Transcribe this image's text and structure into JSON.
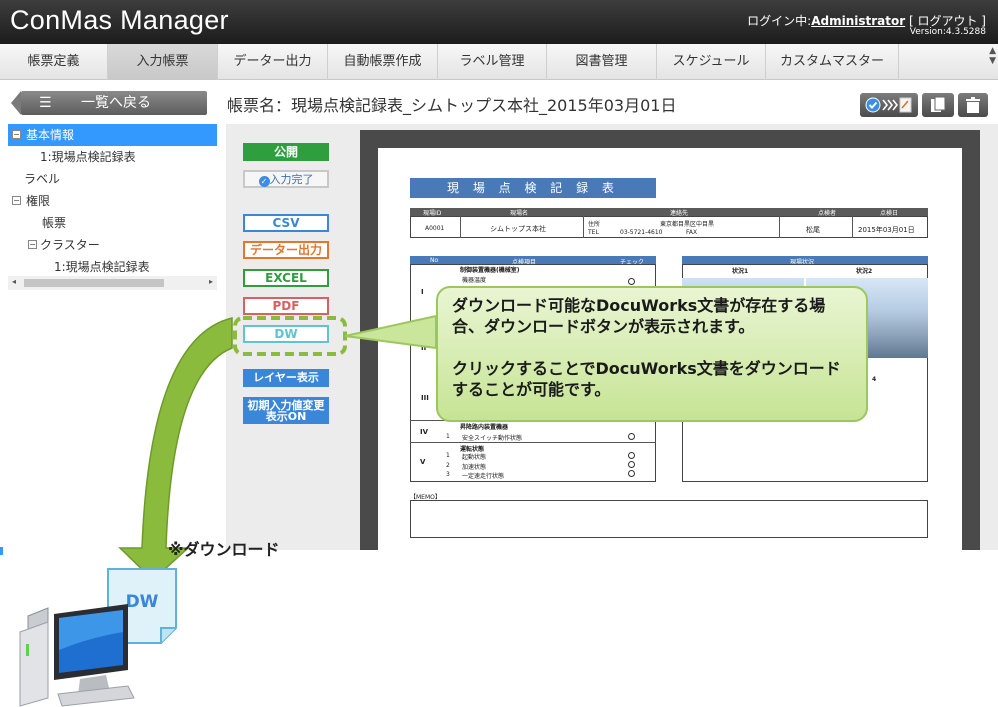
{
  "header": {
    "app_title": "ConMas Manager",
    "login_prefix": "ログイン中:",
    "user": "Administrator",
    "logout": "[ ログアウト ]",
    "version": "Version:4.3.5288"
  },
  "nav": {
    "items": [
      {
        "label": "帳票定義",
        "active": false
      },
      {
        "label": "入力帳票",
        "active": true
      },
      {
        "label": "データー出力",
        "active": false
      },
      {
        "label": "自動帳票作成",
        "active": false
      },
      {
        "label": "ラベル管理",
        "active": false
      },
      {
        "label": "図書管理",
        "active": false
      },
      {
        "label": "スケジュール",
        "active": false
      },
      {
        "label": "カスタムマスター",
        "active": false
      }
    ]
  },
  "toolbar": {
    "back_label": "一覧へ戻る",
    "form_title": "帳票名：現場点検記録表_シムトップス本社_2015年03月01日"
  },
  "tree": {
    "items": [
      {
        "label": "基本情報",
        "level": 0,
        "toggle": "−",
        "selected": true
      },
      {
        "label": "1:現場点検記録表",
        "level": 2,
        "toggle": "",
        "selected": false
      },
      {
        "label": "ラベル",
        "level": 0,
        "toggle": "",
        "selected": false
      },
      {
        "label": "権限",
        "level": 0,
        "toggle": "−",
        "selected": false
      },
      {
        "label": "帳票",
        "level": 1,
        "toggle": "",
        "selected": false
      },
      {
        "label": "クラスター",
        "level": 1,
        "toggle": "−",
        "selected": false
      },
      {
        "label": "1:現場点検記録表",
        "level": 2,
        "toggle": "",
        "selected": false
      }
    ]
  },
  "side_buttons": {
    "publish": "公開",
    "input_done": "入力完了",
    "csv": "CSV",
    "data_out": "データー出力",
    "excel": "EXCEL",
    "pdf": "PDF",
    "dw": "DW",
    "layer": "レイヤー表示",
    "initial_line1": "初期入力値変更",
    "initial_line2": "表示ON"
  },
  "document": {
    "title": "現 場 点 検 記 録 表",
    "site_id_label": "現場ID",
    "site_name_label": "現場名",
    "contact_label": "連絡先",
    "inspector_label": "点検者",
    "date_label": "点検日",
    "site_id": "A0001",
    "site_name": "シムトップス本社",
    "address_label": "住所",
    "address": "東京都目黒区中目黒",
    "tel_label": "TEL",
    "tel": "03-5721-4610",
    "fax_label": "FAX",
    "inspector": "松尾",
    "date": "2015年03月01日",
    "no_label": "No",
    "item_label": "点検項目",
    "check_label": "チェック",
    "status_label": "現場状況",
    "status1": "状況1",
    "status2": "状況2",
    "status4_fragment": "4",
    "sec1_title": "制御装置機器(機械室)",
    "sec1_first": "機器温度",
    "sec4_title": "昇降路内装置機器",
    "sec4_item": "安全スイッチ動作状態",
    "sec5_title": "運転状態",
    "sec5_items": [
      "起動状態",
      "加速状態",
      "一定速走行状態"
    ],
    "roman": [
      "I",
      "II",
      "III",
      "IV",
      "V"
    ],
    "memo_label": "【MEMO】"
  },
  "callout": {
    "line1": "ダウンロード可能なDocuWorks文書が存在する場合、ダウンロードボタンが表示されます。",
    "line2": "クリックすることでDocuWorks文書をダウンロードすることが可能です。"
  },
  "download": {
    "label": "※ダウンロード",
    "file_label": "DW"
  },
  "colors": {
    "accent_blue": "#3399ff",
    "publish_green": "#2f9e3f",
    "csv_blue": "#3a86d8",
    "excel_green": "#2f9e3f",
    "pdf_red": "#d86060",
    "dw_cyan": "#5fc4d0",
    "callout_green": "#c6e494",
    "arrow_green": "#8bbb3c"
  }
}
